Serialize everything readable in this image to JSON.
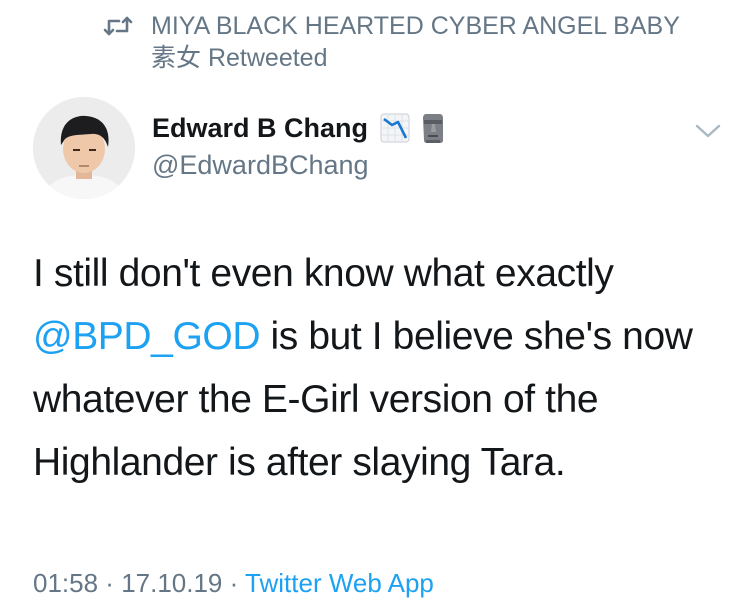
{
  "retweet": {
    "retweeter_line1": "MIYA BLACK HEARTED CYBER ANGEL BABY",
    "retweeter_line2_name": "素女",
    "retweeted_label": "Retweeted"
  },
  "author": {
    "display_name": "Edward B Chang",
    "handle": "@EdwardBChang",
    "name_emojis": [
      "chart-decreasing-emoji",
      "moai-emoji"
    ]
  },
  "tweet": {
    "text_part1": "I still don't even know what exactly",
    "mention": "@BPD_GOD",
    "text_part2": " is but I believe she's now whatever the E-Girl version of the Highlander is after slaying Tara."
  },
  "meta": {
    "time": "01:58",
    "separator": " · ",
    "date": "17.10.19",
    "source": "Twitter Web App"
  },
  "colors": {
    "text": "#14171a",
    "secondary": "#657786",
    "link": "#1da1f2"
  }
}
